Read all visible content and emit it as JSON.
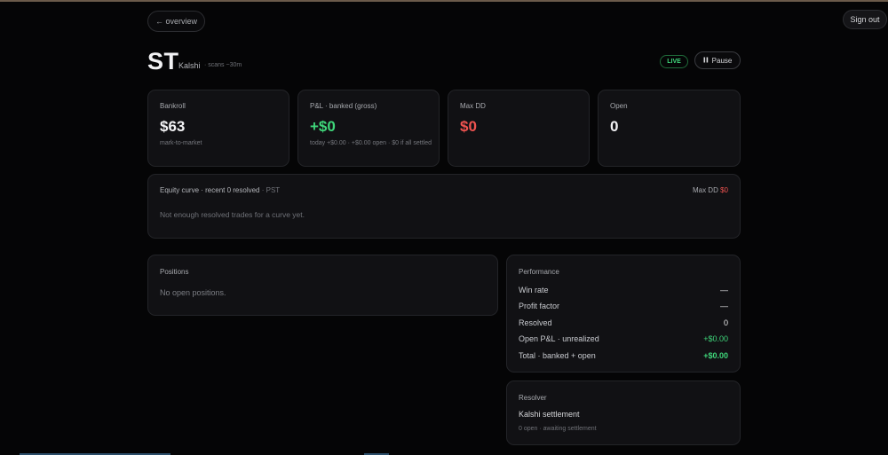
{
  "nav": {
    "overview_label": "← overview",
    "signout_label": "Sign out"
  },
  "header": {
    "title": "ST",
    "exchange": "Kalshi",
    "scan_info": "· scans ~30m",
    "status_badge": "LIVE",
    "pause_icon": "pause-icon",
    "pause_label": "Pause"
  },
  "stats": [
    {
      "label": "Bankroll",
      "value": "$63",
      "sub": "mark-to-market"
    },
    {
      "label": "P&L · banked (gross)",
      "value": "+$0",
      "sub": "today +$0.00 · +$0.00 open · $0 if all settled"
    },
    {
      "label": "Max DD",
      "value": "$0",
      "sub": ""
    },
    {
      "label": "Open",
      "value": "0",
      "sub": ""
    }
  ],
  "equity": {
    "title": "Equity curve · recent 0 resolved",
    "timezone": "· PST",
    "maxdd_label": "Max DD",
    "maxdd_value": "$0",
    "empty_message": "Not enough resolved trades for a curve yet."
  },
  "positions": {
    "title": "Positions",
    "empty_message": "No open positions."
  },
  "performance": {
    "title": "Performance",
    "rows": [
      {
        "label": "Win rate",
        "value": "—"
      },
      {
        "label": "Profit factor",
        "value": "—"
      },
      {
        "label": "Resolved",
        "value": "0"
      },
      {
        "label": "Open P&L · unrealized",
        "value": "+$0.00"
      },
      {
        "label": "Total · banked + open",
        "value": "+$0.00"
      }
    ]
  },
  "resolver": {
    "title": "Resolver",
    "name": "Kalshi settlement",
    "status": "0 open · awaiting settlement"
  },
  "colors": {
    "positive": "#3fd67a",
    "negative": "#ef5350",
    "background": "#050506",
    "card": "#111114"
  }
}
